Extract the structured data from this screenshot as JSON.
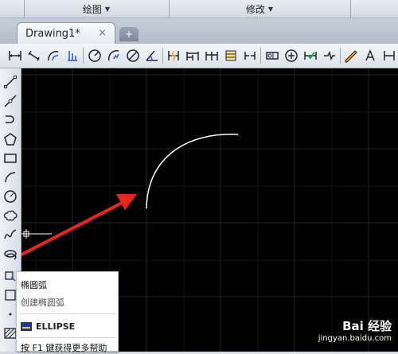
{
  "ribbon": {
    "panels": [
      {
        "label": "绘图"
      },
      {
        "label": "修改"
      }
    ]
  },
  "tabs": {
    "document_tab": "Drawing1*",
    "close_symbol": "×",
    "new_tab_symbol": "+"
  },
  "tooltip": {
    "title": "椭圆弧",
    "description": "创建椭圆弧",
    "command": "ELLIPSE",
    "help_text": "按 F1 键获得更多帮助"
  },
  "watermark": {
    "brand": "Bai 经验",
    "url": "jingyan.baidu.com"
  },
  "colors": {
    "canvas_bg": "#000000",
    "arc": "#ffffff",
    "arrow": "#e8261c",
    "grid": "#2a2a2a"
  },
  "toolbar_icons": [
    "linear-dim-icon",
    "aligned-dim-icon",
    "arc-length-dim-icon",
    "ordinate-dim-icon",
    "radius-dim-icon",
    "jogged-dim-icon",
    "diameter-dim-icon",
    "angular-dim-icon",
    "quick-dim-icon",
    "baseline-dim-icon",
    "continue-dim-icon",
    "dim-space-icon",
    "dim-break-icon",
    "tolerance-icon",
    "center-mark-icon",
    "inspect-icon",
    "jogged-linear-icon",
    "dim-edit-icon",
    "dim-text-edit-icon",
    "dim-update-icon"
  ],
  "draw_icons": [
    "line-icon",
    "construction-line-icon",
    "polyline-icon",
    "polygon-icon",
    "rectangle-icon",
    "arc-icon",
    "circle-icon",
    "revision-cloud-icon",
    "spline-icon",
    "ellipse-icon",
    "ellipse-arc-icon"
  ]
}
